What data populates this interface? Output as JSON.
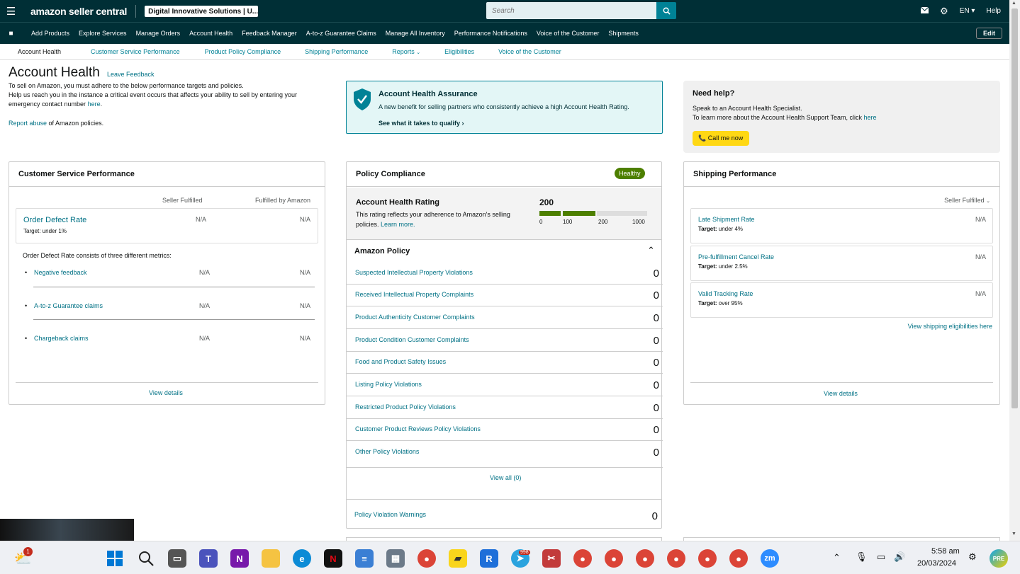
{
  "topbar": {
    "brand": "amazon seller central",
    "account": "Digital Innovative Solutions | U...",
    "search_placeholder": "Search",
    "lang": "EN",
    "help": "Help"
  },
  "nav": {
    "items": [
      "Add Products",
      "Explore Services",
      "Manage Orders",
      "Account Health",
      "Feedback Manager",
      "A-to-z Guarantee Claims",
      "Manage All Inventory",
      "Performance Notifications",
      "Voice of the Customer",
      "Shipments"
    ],
    "edit": "Edit"
  },
  "subnav": {
    "items": [
      "Account Health",
      "Customer Service Performance",
      "Product Policy Compliance",
      "Shipping Performance",
      "Reports",
      "Eligibilities",
      "Voice of the Customer"
    ]
  },
  "header": {
    "title": "Account Health",
    "leave_feedback": "Leave Feedback",
    "intro1": "To sell on Amazon, you must adhere to the below performance targets and policies.",
    "intro2": "Help us reach you in the instance a critical event occurs that affects your ability to sell by entering your emergency contact number",
    "here": "here",
    "period": ".",
    "report_abuse": "Report abuse",
    "report_tail": " of Amazon policies."
  },
  "aha": {
    "title": "Account Health Assurance",
    "desc": "A new benefit for selling partners who consistently achieve a high Account Health Rating.",
    "qualify": "See what it takes to qualify"
  },
  "help": {
    "title": "Need help?",
    "line1": "Speak to an Account Health Specialist.",
    "line2": "To learn more about the Account Health Support Team, click",
    "here": "here",
    "call": "Call me now"
  },
  "csp": {
    "title": "Customer Service Performance",
    "col1": "Seller Fulfilled",
    "col2": "Fulfilled by Amazon",
    "odr": "Order Defect Rate",
    "odr_target": "Target: under 1%",
    "odr_v1": "N/A",
    "odr_v2": "N/A",
    "note": "Order Defect Rate consists of three different metrics:",
    "metrics": [
      {
        "label": "Negative feedback",
        "v1": "N/A",
        "v2": "N/A"
      },
      {
        "label": "A-to-z Guarantee claims",
        "v1": "N/A",
        "v2": "N/A"
      },
      {
        "label": "Chargeback claims",
        "v1": "N/A",
        "v2": "N/A"
      }
    ],
    "view": "View details"
  },
  "pc": {
    "title": "Policy Compliance",
    "badge": "Healthy",
    "ahr_title": "Account Health Rating",
    "ahr_desc1": "This rating reflects your adherence to Amazon's selling",
    "ahr_desc2": "policies.",
    "learn": "Learn more.",
    "score": "200",
    "ticks": [
      "0",
      "100",
      "200",
      "1000"
    ],
    "policy_title": "Amazon Policy",
    "rows": [
      {
        "label": "Suspected Intellectual Property Violations",
        "value": "0"
      },
      {
        "label": "Received Intellectual Property Complaints",
        "value": "0"
      },
      {
        "label": "Product Authenticity Customer Complaints",
        "value": "0"
      },
      {
        "label": "Product Condition Customer Complaints",
        "value": "0"
      },
      {
        "label": "Food and Product Safety Issues",
        "value": "0"
      },
      {
        "label": "Listing Policy Violations",
        "value": "0"
      },
      {
        "label": "Restricted Product Policy Violations",
        "value": "0"
      },
      {
        "label": "Customer Product Reviews Policy Violations",
        "value": "0"
      },
      {
        "label": "Other Policy Violations",
        "value": "0"
      }
    ],
    "view_all": "View all (0)",
    "warnings": "Policy Violation Warnings",
    "warnings_value": "0"
  },
  "sp": {
    "title": "Shipping Performance",
    "filter": "Seller Fulfilled",
    "metrics": [
      {
        "label": "Late Shipment Rate",
        "target_label": "Target:",
        "target": " under 4%",
        "value": "N/A"
      },
      {
        "label": "Pre-fulfillment Cancel Rate",
        "target_label": "Target:",
        "target": " under 2.5%",
        "value": "N/A"
      },
      {
        "label": "Valid Tracking Rate",
        "target_label": "Target:",
        "target": " over 95%",
        "value": "N/A"
      }
    ],
    "eligibilities": "View shipping eligibilities here",
    "view": "View details"
  },
  "taskbar": {
    "time": "5:58 am",
    "date": "20/03/2024",
    "weather_badge": "1",
    "telegram_badge": "998"
  }
}
